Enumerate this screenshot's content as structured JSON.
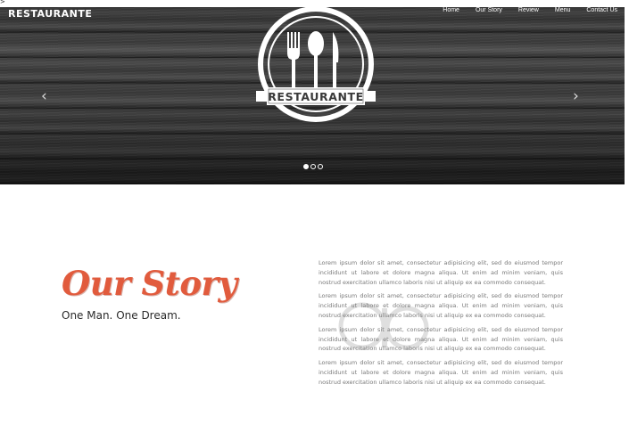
{
  "page": {
    "stray_text": ">"
  },
  "header": {
    "brand": "RESTAURANTE",
    "nav": [
      "Home",
      "Our Story",
      "Review",
      "Menu",
      "Contact Us"
    ]
  },
  "hero": {
    "emblem_text": "RESTAURANTE",
    "prev_icon": "chevron-left-icon",
    "next_icon": "chevron-right-icon",
    "slides": {
      "count": 3,
      "active_index": 0
    }
  },
  "story": {
    "title": "Our Story",
    "subtitle": "One Man. One Dream.",
    "paragraphs": [
      "Lorem ipsum dolor sit amet, consectetur adipisicing elit, sed do eiusmod tempor incididunt ut labore et dolore magna aliqua. Ut enim ad minim veniam, quis nostrud exercitation ullamco laboris nisi ut aliquip ex ea commodo consequat.",
      "Lorem ipsum dolor sit amet, consectetur adipisicing elit, sed do eiusmod tempor incididunt ut labore et dolore magna aliqua. Ut enim ad minim veniam, quis nostrud exercitation ullamco laboris nisi ut aliquip ex ea commodo consequat.",
      "Lorem ipsum dolor sit amet, consectetur adipisicing elit, sed do eiusmod tempor incididunt ut labore et dolore magna aliqua. Ut enim ad minim veniam, quis nostrud exercitation ullamco laboris nisi ut aliquip ex ea commodo consequat.",
      "Lorem ipsum dolor sit amet, consectetur adipisicing elit, sed do eiusmod tempor incididunt ut labore et dolore magna aliqua. Ut enim ad minim veniam, quis nostrud exercitation ullamco laboris nisi ut aliquip ex ea commodo consequat."
    ]
  },
  "colors": {
    "accent": "#e15b3d",
    "heading_dark": "#2b2b2b",
    "body_text": "#7a7a7a",
    "hero_bg": "#2e2e2e"
  }
}
